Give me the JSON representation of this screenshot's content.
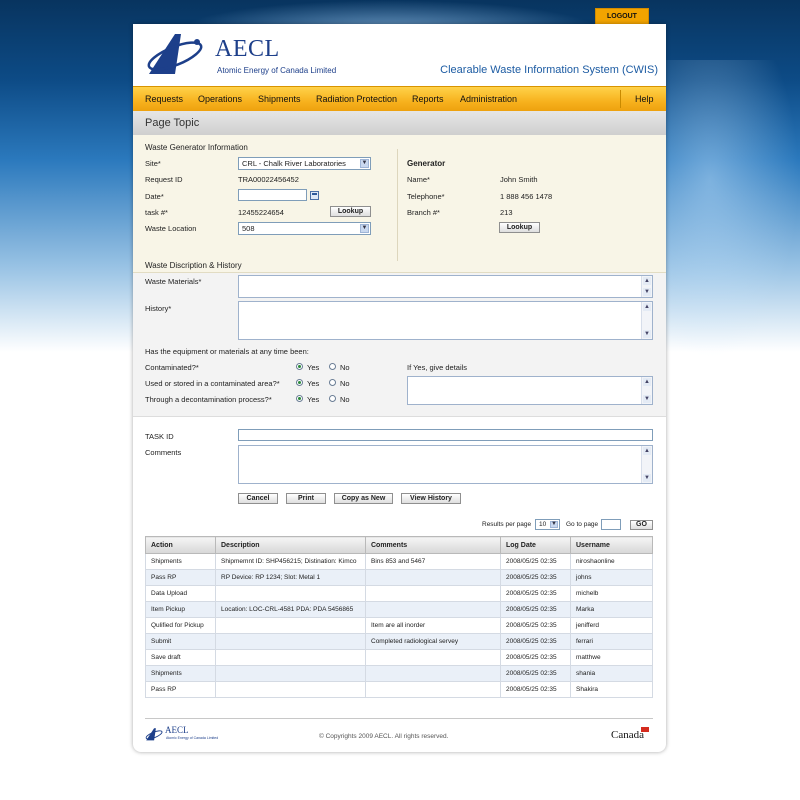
{
  "header": {
    "logout_label": "LOGOUT",
    "logo_name": "AECL",
    "logo_subtitle": "Atomic Energy of Canada Limited",
    "system_title": "Clearable Waste Information System (CWIS)"
  },
  "nav": {
    "items": [
      "Requests",
      "Operations",
      "Shipments",
      "Radiation Protection",
      "Reports",
      "Administration"
    ],
    "help_label": "Help"
  },
  "page_topic": "Page Topic",
  "generator_section": {
    "title": "Waste Generator Information",
    "site_label": "Site*",
    "site_value": "CRL - Chalk River Laboratories",
    "request_id_label": "Request ID",
    "request_id_value": "TRA00022456452",
    "date_label": "Date*",
    "date_value": "",
    "task_label": "task #*",
    "task_value": "12455224654",
    "lookup_label": "Lookup",
    "waste_location_label": "Waste Location",
    "waste_location_value": "508",
    "generator_title": "Generator",
    "name_label": "Name*",
    "name_value": "John Smith",
    "telephone_label": "Telephone*",
    "telephone_value": "1 888 456 1478",
    "branch_label": "Branch #*",
    "branch_value": "213",
    "lookup2_label": "Lookup"
  },
  "description_section": {
    "title": "Waste Discription & History",
    "waste_materials_label": "Waste Materials*",
    "history_label": "History*",
    "question": "Has the equipment or materials at any time been:",
    "contaminated_label": "Contaminated?*",
    "used_stored_label": "Used or stored in a contaminated area?*",
    "decon_label": "Through a decontamination process?*",
    "yes_label": "Yes",
    "no_label": "No",
    "details_label": "If Yes, give details"
  },
  "task_section": {
    "task_id_label": "TASK ID",
    "comments_label": "Comments",
    "buttons": {
      "cancel": "Cancel",
      "print": "Print",
      "copy_as_new": "Copy as New",
      "view_history": "View History"
    }
  },
  "pager": {
    "results_label": "Results per page",
    "results_value": "10",
    "goto_label": "Go to page",
    "goto_value": "",
    "go_label": "GO"
  },
  "table": {
    "headers": [
      "Action",
      "Description",
      "Comments",
      "Log Date",
      "Username"
    ],
    "rows": [
      [
        "Shipments",
        "Shipmemnt ID: SHP456215; Distination: Kimco",
        "Bins 853 and 5467",
        "2008/05/25 02:35",
        "niroshaonline"
      ],
      [
        "Pass RP",
        "RP Device: RP 1234; Slot: Metal 1",
        "",
        "2008/05/25 02:35",
        "johns"
      ],
      [
        "Data Upload",
        "",
        "",
        "2008/05/25 02:35",
        "michelb"
      ],
      [
        "Item Pickup",
        "Location: LOC-CRL-4581 PDA: PDA 5456865",
        "",
        "2008/05/25 02:35",
        "Marka"
      ],
      [
        "Qulified for Pickup",
        "",
        "Item are all inorder",
        "2008/05/25 02:35",
        "jenifferd"
      ],
      [
        "Submit",
        "",
        "Completed radiological servey",
        "2008/05/25 02:35",
        "ferrari"
      ],
      [
        "Save draft",
        "",
        "",
        "2008/05/25 02:35",
        "matthwe"
      ],
      [
        "Shipments",
        "",
        "",
        "2008/05/25 02:35",
        "shania"
      ],
      [
        "Pass RP",
        "",
        "",
        "2008/05/25 02:35",
        "Shakira"
      ]
    ]
  },
  "footer": {
    "logo_name": "AECL",
    "logo_subtitle": "Atomic Energy of Canada Limited",
    "copyright": "© Copyrights 2009 AECL. All rights reserved.",
    "canada_wordmark": "Canada"
  },
  "colors": {
    "nav_yellow": "#f7b21e",
    "logo_blue": "#1d3f8a",
    "form_bg": "#f8f5e7",
    "radio_selected": "#2a8a3a"
  }
}
